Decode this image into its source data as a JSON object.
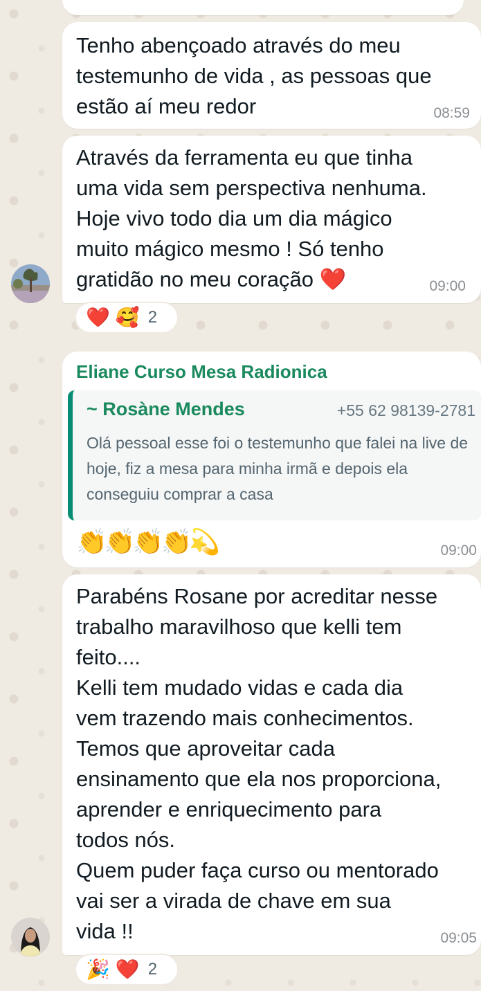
{
  "messages": [
    {
      "text": "Tenho abençoado através do meu\ntestemunho de vida , as pessoas que\nestão aí meu redor",
      "time": "08:59"
    },
    {
      "text": "Através da ferramenta eu que tinha\numa vida sem perspectiva nenhuma.\nHoje vivo todo dia um dia mágico\nmuito mágico mesmo ! Só tenho\ngratidão no meu coração ❤️",
      "time": "09:00",
      "reactions": {
        "emoji1": "❤️",
        "emoji2": "🥰",
        "count": "2"
      }
    },
    {
      "sender": "Eliane Curso Mesa Radionica",
      "quote_author": "~ Rosàne Mendes",
      "quote_phone": "+55 62 98139-2781",
      "quote_text": "Olá pessoal esse foi o testemunho que falei na live de hoje, fiz a mesa para minha irmã e depois ela conseguiu comprar a casa",
      "emoji_text": "👏👏👏👏💫",
      "time": "09:00"
    },
    {
      "text": "Parabéns Rosane por acreditar nesse\ntrabalho maravilhoso que kelli tem\nfeito....\nKelli tem mudado vidas e cada dia\nvem trazendo mais conhecimentos.\nTemos que aproveitar cada\nensinamento que ela nos proporciona,\naprender e enriquecimento para\ntodos nós.\nQuem puder faça curso ou mentorado\nvai ser a virada de chave em sua\nvida !!",
      "time": "09:05",
      "reactions": {
        "emoji1": "🎉",
        "emoji2": "❤️",
        "count": "2"
      }
    }
  ],
  "colors": {
    "background": "#efeae2",
    "bubble": "#ffffff",
    "sender_name": "#1a8a5e",
    "quote_bar": "#068d73",
    "timestamp": "#8a8f93"
  }
}
